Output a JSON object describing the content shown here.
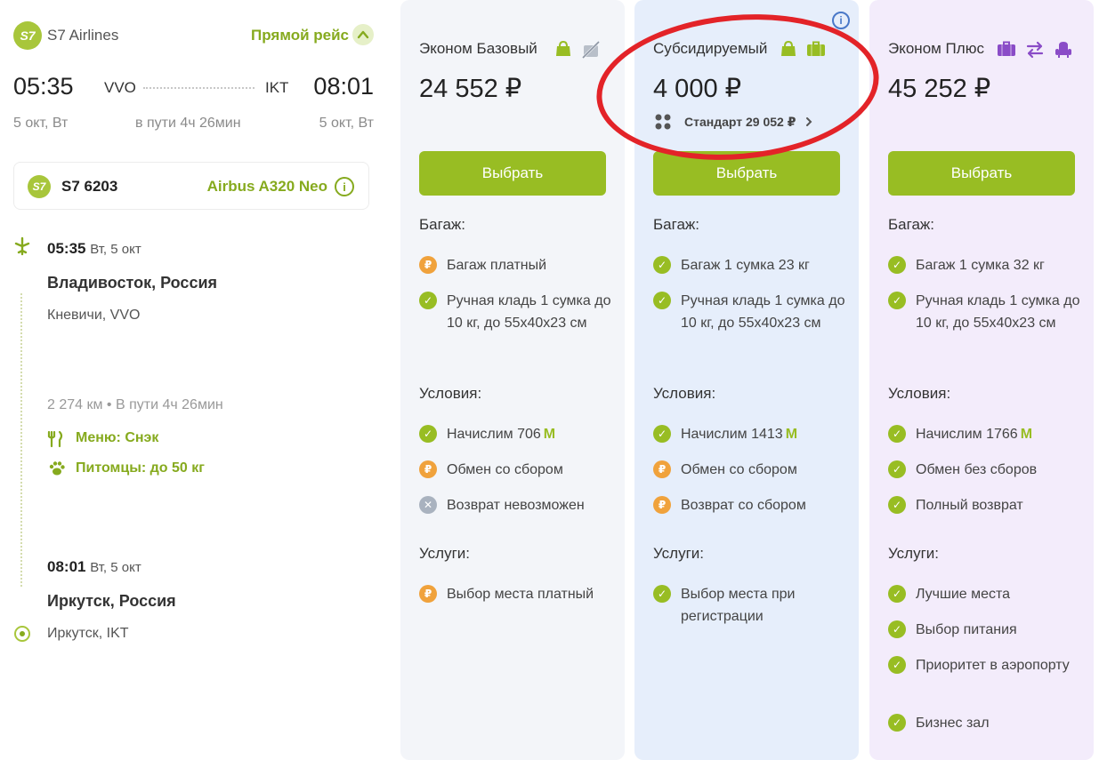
{
  "flight": {
    "airline_logo": "S7",
    "airline": "S7 Airlines",
    "direct": "Прямой рейс",
    "dep_time": "05:35",
    "dep_code": "VVO",
    "arr_code": "IKT",
    "arr_time": "08:01",
    "dep_date": "5 окт, Вт",
    "duration": "в пути 4ч 26мин",
    "arr_date": "5 окт, Вт",
    "flight_number": "S7 6203",
    "aircraft": "Airbus A320 Neo",
    "details": {
      "dep_time": "05:35",
      "dep_day": "Вт, 5 окт",
      "dep_city": "Владивосток, Россия",
      "dep_airport": "Кневичи, VVO",
      "distance": "2 274 км • В пути 4ч 26мин",
      "menu": "Меню: Снэк",
      "pets": "Питомцы: до 50 кг",
      "arr_time": "08:01",
      "arr_day": "Вт, 5 окт",
      "arr_city": "Иркутск, Россия",
      "arr_airport": "Иркутск, IKT"
    }
  },
  "colors": {
    "green": "#98bd23",
    "orange": "#f0a23c",
    "gray": "#a9b2bf",
    "highlight": "#e32328"
  },
  "labels": {
    "baggage": "Багаж:",
    "conditions": "Условия:",
    "services": "Услуги:",
    "select": "Выбрать",
    "miles_icon": "M"
  },
  "fares": [
    {
      "title": "Эконом Базовый",
      "price": "24 552 ₽",
      "icons": [
        "hand-bag-icon",
        "no-baggage-icon"
      ],
      "baggage": [
        {
          "status": "paid",
          "text": "Багаж платный"
        },
        {
          "status": "ok",
          "text": "Ручная кладь 1 сумка до 10 кг, до 55x40x23 см"
        }
      ],
      "conditions": [
        {
          "status": "ok",
          "text": "Начислим 706"
        },
        {
          "status": "paid",
          "text": "Обмен со сбором"
        },
        {
          "status": "no",
          "text": "Возврат невозможен"
        }
      ],
      "services": [
        {
          "status": "paid",
          "text": "Выбор места платный"
        }
      ]
    },
    {
      "title": "Субсидируемый",
      "price": "4 000 ₽",
      "standard": "Стандарт 29 052 ₽",
      "icons": [
        "hand-bag-icon",
        "suitcase-icon"
      ],
      "baggage": [
        {
          "status": "ok",
          "text": "Багаж 1 сумка 23 кг"
        },
        {
          "status": "ok",
          "text": "Ручная кладь 1 сумка до 10 кг, до 55x40x23 см"
        }
      ],
      "conditions": [
        {
          "status": "ok",
          "text": "Начислим 1413"
        },
        {
          "status": "paid",
          "text": "Обмен со сбором"
        },
        {
          "status": "paid",
          "text": "Возврат со сбором"
        }
      ],
      "services": [
        {
          "status": "ok",
          "text": "Выбор места при регистрации"
        }
      ]
    },
    {
      "title": "Эконом Плюс",
      "price": "45 252 ₽",
      "icons": [
        "suitcase-icon",
        "exchange-icon",
        "seat-icon"
      ],
      "baggage": [
        {
          "status": "ok",
          "text": "Багаж 1 сумка 32 кг"
        },
        {
          "status": "ok",
          "text": "Ручная кладь 1 сумка до 10 кг, до 55x40x23 см"
        }
      ],
      "conditions": [
        {
          "status": "ok",
          "text": "Начислим 1766"
        },
        {
          "status": "ok",
          "text": "Обмен без сборов"
        },
        {
          "status": "ok",
          "text": "Полный возврат"
        }
      ],
      "services": [
        {
          "status": "ok",
          "text": "Лучшие места"
        },
        {
          "status": "ok",
          "text": "Выбор питания"
        },
        {
          "status": "ok",
          "text": "Приоритет в аэропорту"
        },
        {
          "status": "ok",
          "text": "Бизнес зал"
        }
      ]
    }
  ]
}
